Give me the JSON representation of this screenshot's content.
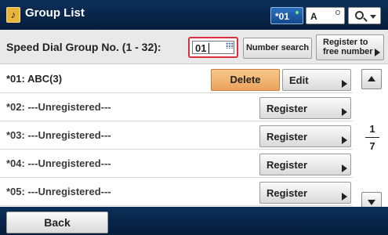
{
  "header": {
    "title": "Group List",
    "icon": "phonebook-icon",
    "speed_dial_label": "*01",
    "alpha_label": "A",
    "search_icon": "search-icon"
  },
  "search": {
    "label": "Speed Dial Group No. (1 - 32):",
    "value": "01",
    "number_search_label": "Number search",
    "register_free_label_1": "Register to",
    "register_free_label_2": "free number"
  },
  "rows": [
    {
      "text": "*01: ABC(3)",
      "delete_label": "Delete",
      "action_label": "Edit"
    },
    {
      "text": "*02: ---Unregistered---",
      "action_label": "Register"
    },
    {
      "text": "*03: ---Unregistered---",
      "action_label": "Register"
    },
    {
      "text": "*04: ---Unregistered---",
      "action_label": "Register"
    },
    {
      "text": "*05: ---Unregistered---",
      "action_label": "Register"
    }
  ],
  "pagination": {
    "current": "1",
    "total": "7"
  },
  "footer": {
    "back_label": "Back"
  },
  "colors": {
    "header_bg": "#0b2f5a",
    "delete_bg": "#eba25c",
    "input_border": "#d9303a",
    "speed_btn_bg": "#2c6fbf"
  }
}
